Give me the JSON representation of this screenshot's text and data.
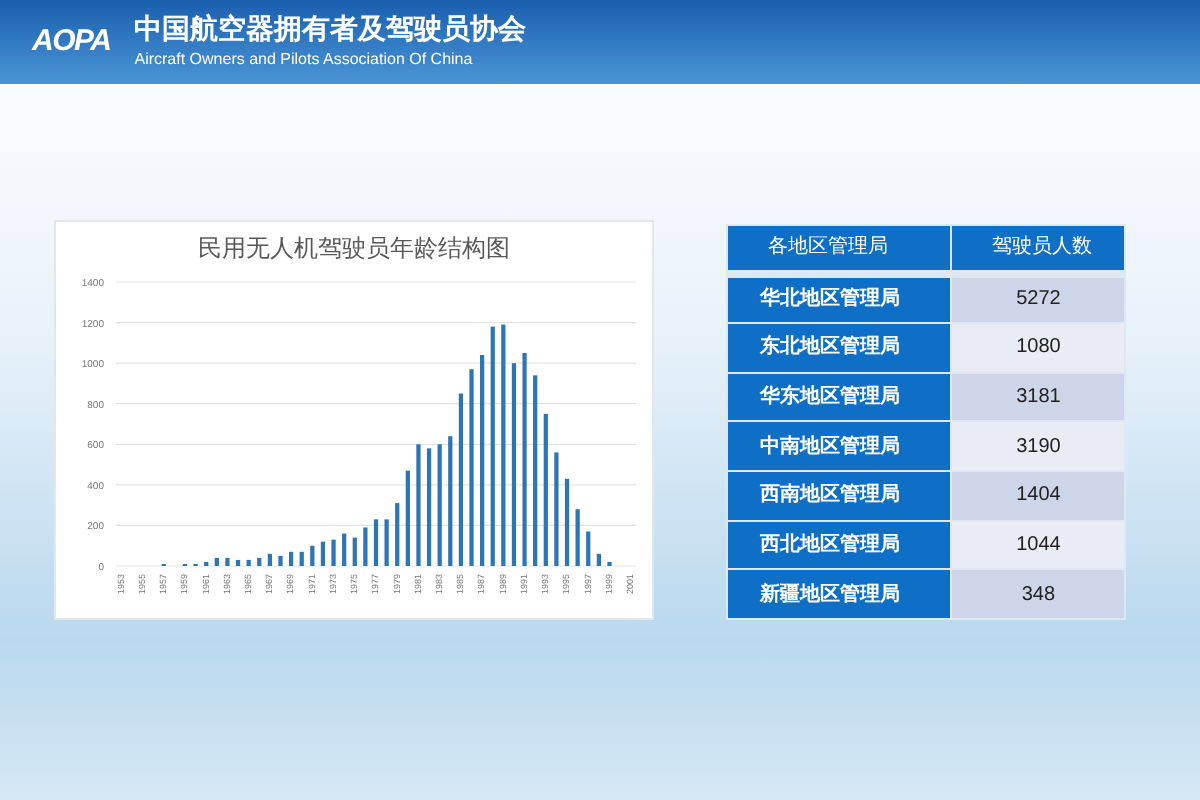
{
  "header": {
    "logo": "AOPA",
    "title": "中国航空器拥有者及驾驶员协会",
    "subtitle": "Aircraft Owners and Pilots Association Of China"
  },
  "chart": {
    "chart_data": {
      "type": "bar",
      "title": "民用无人机驾驶员年龄结构图",
      "x": [
        1953,
        1954,
        1955,
        1956,
        1957,
        1958,
        1959,
        1960,
        1961,
        1962,
        1963,
        1964,
        1965,
        1966,
        1967,
        1968,
        1969,
        1970,
        1971,
        1972,
        1973,
        1974,
        1975,
        1976,
        1977,
        1978,
        1979,
        1980,
        1981,
        1982,
        1983,
        1984,
        1985,
        1986,
        1987,
        1988,
        1989,
        1990,
        1991,
        1992,
        1993,
        1994,
        1995,
        1996,
        1997,
        1998,
        1999,
        2000,
        2001
      ],
      "xlim": [
        1952.5,
        2001.5
      ],
      "xticks": [
        1953,
        1955,
        1957,
        1959,
        1961,
        1963,
        1965,
        1967,
        1969,
        1971,
        1973,
        1975,
        1977,
        1979,
        1981,
        1983,
        1985,
        1987,
        1989,
        1991,
        1993,
        1995,
        1997,
        1999,
        2001
      ],
      "series": [
        {
          "color": "#2e75b6",
          "values": [
            0,
            0,
            0,
            0,
            10,
            0,
            10,
            10,
            20,
            40,
            40,
            30,
            30,
            40,
            60,
            50,
            70,
            70,
            100,
            120,
            130,
            160,
            140,
            190,
            230,
            230,
            310,
            470,
            600,
            580,
            600,
            640,
            850,
            970,
            1040,
            1180,
            1190,
            1000,
            1050,
            940,
            750,
            560,
            430,
            280,
            170,
            60,
            20,
            0,
            0
          ]
        }
      ],
      "ylim": [
        0,
        1400
      ],
      "yticks": [
        0,
        200,
        400,
        600,
        800,
        1000,
        1200,
        1400
      ],
      "grid": true
    }
  },
  "table": {
    "columns": [
      "各地区管理局",
      "驾驶员人数"
    ],
    "rows": [
      [
        "华北地区管理局",
        "5272"
      ],
      [
        "东北地区管理局",
        "1080"
      ],
      [
        "华东地区管理局",
        "3181"
      ],
      [
        "中南地区管理局",
        "3190"
      ],
      [
        "西南地区管理局",
        "1404"
      ],
      [
        "西北地区管理局",
        "1044"
      ],
      [
        "新疆地区管理局",
        "348"
      ]
    ]
  }
}
